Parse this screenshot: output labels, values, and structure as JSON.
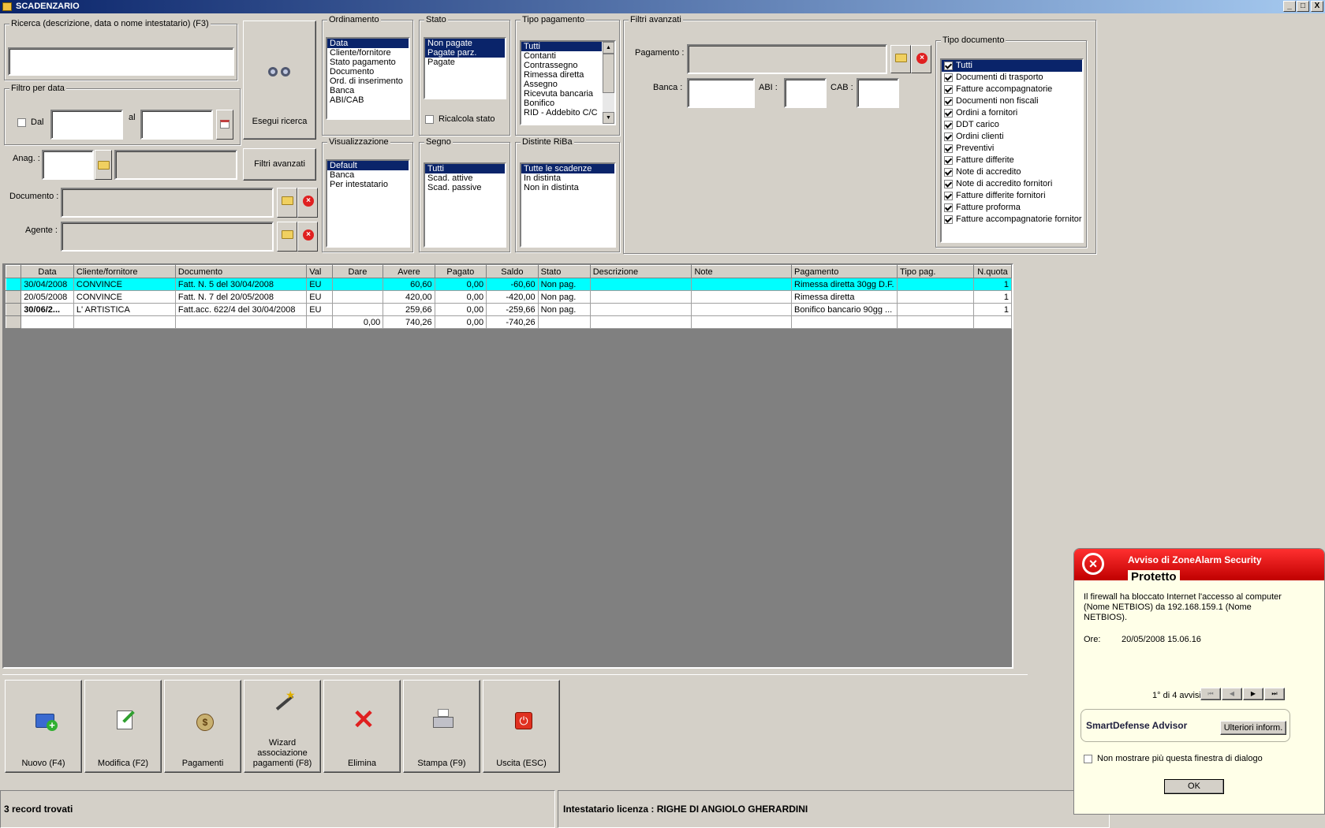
{
  "window": {
    "title": "SCADENZARIO",
    "min": "_",
    "max": "□",
    "close": "X"
  },
  "search": {
    "legend": "Ricerca (descrizione, data o nome intestatario) (F3)",
    "value": "",
    "button": "Esegui ricerca"
  },
  "date_filter": {
    "legend": "Filtro per data",
    "from_label": "Dal",
    "to_label": "al",
    "from_value": "",
    "to_value": ""
  },
  "anag": {
    "label": "Anag. :",
    "code": "",
    "name": ""
  },
  "filters_button": "Filtri avanzati",
  "documento": {
    "label": "Documento :",
    "value": ""
  },
  "agente": {
    "label": "Agente :",
    "value": ""
  },
  "ordinamento": {
    "legend": "Ordinamento",
    "items": [
      "Data",
      "Cliente/fornitore",
      "Stato pagamento",
      "Documento",
      "Ord. di inserimento",
      "Banca",
      "ABI/CAB"
    ],
    "selected": 0
  },
  "stato": {
    "legend": "Stato",
    "items": [
      "Non pagate",
      "Pagate parz.",
      "Pagate"
    ],
    "ricalcola": "Ricalcola stato"
  },
  "tipo_pagamento": {
    "legend": "Tipo pagamento",
    "items": [
      "Tutti",
      "Contanti",
      "Contrassegno",
      "Rimessa diretta",
      "Assegno",
      "Ricevuta bancaria",
      "Bonifico",
      "RID - Addebito C/C"
    ]
  },
  "visualizzazione": {
    "legend": "Visualizzazione",
    "items": [
      "Default",
      "Banca",
      "Per intestatario"
    ]
  },
  "segno": {
    "legend": "Segno",
    "items": [
      "Tutti",
      "Scad. attive",
      "Scad. passive"
    ]
  },
  "distinte": {
    "legend": "Distinte RiBa",
    "items": [
      "Tutte le scadenze",
      "In distinta",
      "Non in distinta"
    ]
  },
  "filtri_avanzati": {
    "legend": "Filtri avanzati",
    "pagamento_label": "Pagamento :",
    "banca_label": "Banca :",
    "abi_label": "ABI :",
    "cab_label": "CAB :",
    "pagamento": "",
    "banca": "",
    "abi": "",
    "cab": ""
  },
  "tipo_documento": {
    "legend": "Tipo documento",
    "items": [
      "Tutti",
      "Documenti di trasporto",
      "Fatture accompagnatorie",
      "Documenti non fiscali",
      "Ordini a fornitori",
      "DDT carico",
      "Ordini clienti",
      "Preventivi",
      "Fatture differite",
      "Note di accredito",
      "Note di accredito fornitori",
      "Fatture differite fornitori",
      "Fatture proforma",
      "Fatture accompagnatorie fornitori"
    ]
  },
  "grid": {
    "columns": [
      "Data",
      "Cliente/fornitore",
      "Documento",
      "Val",
      "Dare",
      "Avere",
      "Pagato",
      "Saldo",
      "Stato",
      "Descrizione",
      "Note",
      "Pagamento",
      "Tipo pag.",
      "N.quota"
    ],
    "rows": [
      [
        "30/04/2008",
        "CONVINCE",
        "Fatt. N. 5 del 30/04/2008",
        "EU",
        "",
        "60,60",
        "0,00",
        "-60,60",
        "Non pag.",
        "",
        "",
        "Rimessa diretta 30gg D.F.",
        "",
        "1"
      ],
      [
        "20/05/2008",
        "CONVINCE",
        "Fatt. N. 7 del 20/05/2008",
        "EU",
        "",
        "420,00",
        "0,00",
        "-420,00",
        "Non pag.",
        "",
        "",
        "Rimessa diretta",
        "",
        "1"
      ],
      [
        "30/06/2...",
        "L' ARTISTICA",
        "Fatt.acc. 622/4 del 30/04/2008",
        "EU",
        "",
        "259,66",
        "0,00",
        "-259,66",
        "Non pag.",
        "",
        "",
        "Bonifico bancario 90gg ...",
        "",
        "1"
      ]
    ],
    "totals": [
      "",
      "",
      "",
      "",
      "0,00",
      "740,26",
      "0,00",
      "-740,26",
      "",
      "",
      "",
      "",
      "",
      ""
    ]
  },
  "buttons": {
    "nuovo": "Nuovo (F4)",
    "modifica": "Modifica (F2)",
    "pagamenti": "Pagamenti",
    "wizard": "Wizard associazione pagamenti (F8)",
    "elimina": "Elimina",
    "stampa": "Stampa (F9)",
    "uscita": "Uscita (ESC)"
  },
  "status": {
    "records": "3 record trovati",
    "licenza": "Intestatario licenza : RIGHE DI ANGIOLO GHERARDINI"
  },
  "zonealarm": {
    "title": "Avviso di ZoneAlarm Security",
    "subtitle": "Protetto",
    "message": "Il firewall ha bloccato Internet l'accesso al computer (Nome NETBIOS) da 192.168.159.1 (Nome NETBIOS).",
    "ore_label": "Ore:",
    "ore_value": "20/05/2008 15.06.16",
    "counter": "1° di 4 avvisi",
    "advisor": "SmartDefense Advisor",
    "more_button": "Ulteriori inform.",
    "dont_show": "Non mostrare più questa finestra di dialogo",
    "ok": "OK"
  }
}
